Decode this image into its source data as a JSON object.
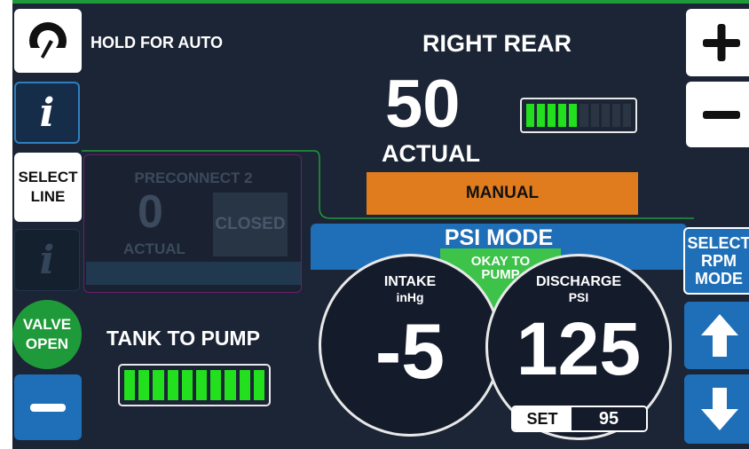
{
  "left_panel": {
    "hold_for_auto": "HOLD FOR AUTO",
    "select_line": "SELECT\nLINE",
    "valve_status": "VALVE\nOPEN",
    "tank_to_pump": "TANK TO PUMP",
    "tank_level": 1.0
  },
  "line": {
    "title": "RIGHT REAR",
    "actual_value": "50",
    "actual_label": "ACTUAL",
    "mode_badge": "MANUAL",
    "level": 0.5
  },
  "preconnect": {
    "name": "PRECONNECT 2",
    "actual_value": "0",
    "actual_label": "ACTUAL",
    "status": "CLOSED"
  },
  "pump": {
    "mode_label": "PSI MODE",
    "okay_text": "OKAY TO\nPUMP",
    "intake_label": "INTAKE",
    "intake_unit": "inHg",
    "intake_value": "-5",
    "discharge_label": "DISCHARGE",
    "discharge_unit": "PSI",
    "discharge_value": "125",
    "set_label": "SET",
    "set_value": "95",
    "rpm_mode_button": "SELECT\nRPM\nMODE"
  },
  "colors": {
    "background": "#1c2535",
    "accent_blue": "#1f6fb8",
    "bar_green": "#22e01e",
    "valve_green": "#1f9a3a",
    "manual_orange": "#e07c1e"
  },
  "icons": {
    "gauge": "gauge-icon",
    "info": "info-icon",
    "plus": "plus-icon",
    "minus": "minus-icon",
    "up": "arrow-up-icon",
    "down": "arrow-down-icon"
  }
}
